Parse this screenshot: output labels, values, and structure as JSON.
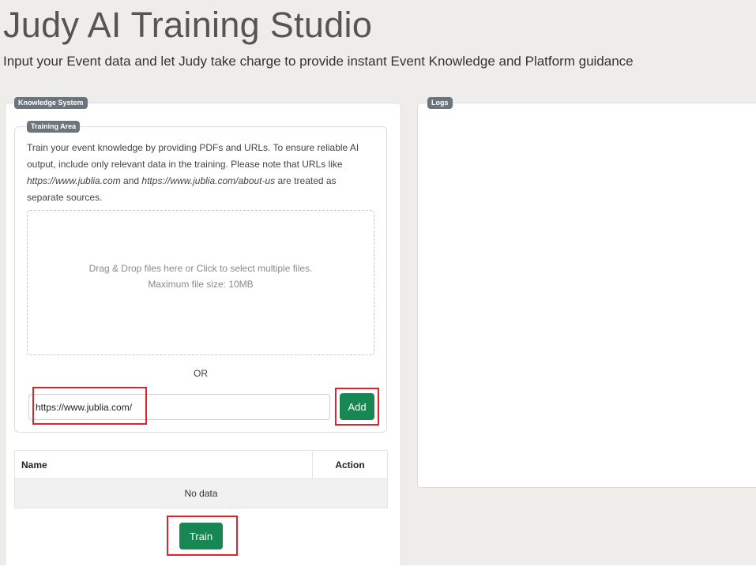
{
  "header": {
    "title": "Judy AI Training Studio",
    "subtitle": "Input your Event data and let Judy take charge to provide instant Event Knowledge and Platform guidance"
  },
  "knowledge_panel": {
    "tag": "Knowledge System",
    "training_area": {
      "tag": "Training Area",
      "description": {
        "part1": "Train your event knowledge by providing PDFs and URLs. To ensure reliable AI output, include only relevant data in the training. Please note that URLs like ",
        "url1": "https://www.jublia.com",
        "part2": " and ",
        "url2": "https://www.jublia.com/about-us",
        "part3": " are treated as separate sources."
      },
      "dropzone": {
        "line1": "Drag & Drop files here or Click to select multiple files.",
        "line2": "Maximum file size: 10MB"
      },
      "or_label": "OR",
      "url_input_value": "https://www.jublia.com/",
      "add_label": "Add"
    },
    "table": {
      "columns": [
        "Name",
        "Action"
      ],
      "empty_text": "No data"
    },
    "train_label": "Train"
  },
  "logs_panel": {
    "tag": "Logs"
  },
  "colors": {
    "background": "#eeede9",
    "primary_button": "#198754",
    "tag": "#6c757d",
    "highlight": "#e8202a"
  }
}
